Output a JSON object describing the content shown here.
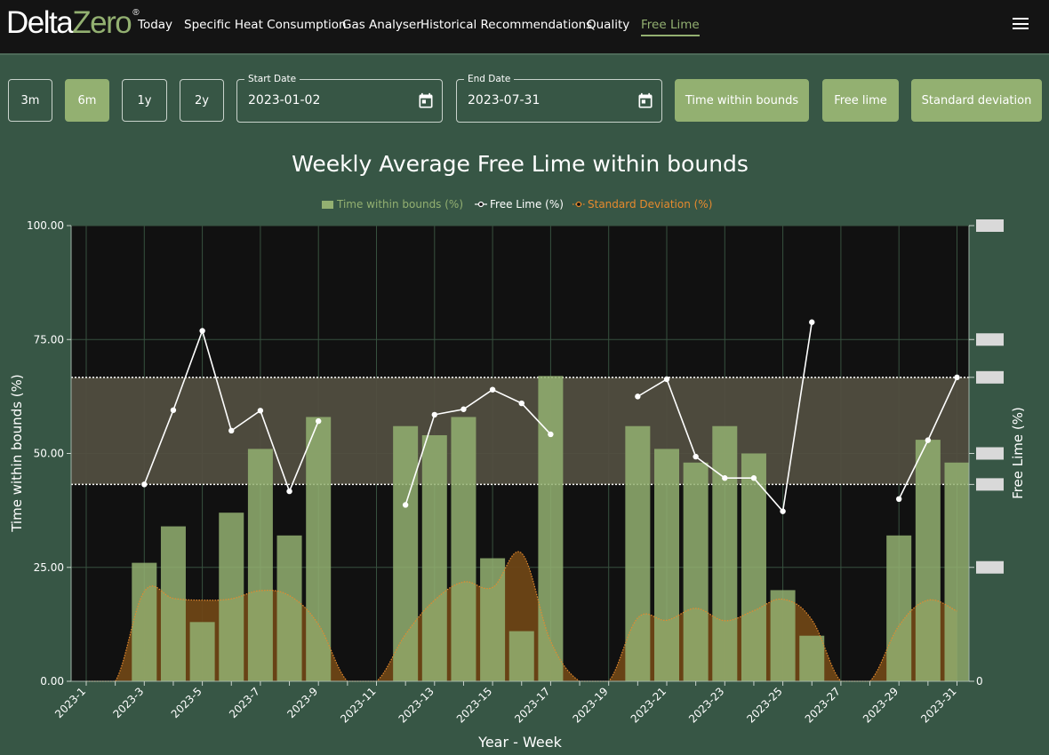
{
  "app": {
    "logo_part1": "Delta",
    "logo_part2": "Zero",
    "logo_mark": "®"
  },
  "nav": {
    "items": [
      "Today",
      "Specific Heat Consumption",
      "Gas Analyser",
      "Historical Recommendations",
      "Quality",
      "Free Lime"
    ],
    "active": "Free Lime",
    "menu_icon": "hamburger-menu-icon"
  },
  "controls": {
    "ranges": [
      "3m",
      "6m",
      "1y",
      "2y"
    ],
    "active_range": "6m",
    "start_date": {
      "label": "Start Date",
      "value": "2023-01-02"
    },
    "end_date": {
      "label": "End Date",
      "value": "2023-07-31"
    },
    "calendar_icon": "calendar-icon",
    "metric_buttons": [
      "Time within bounds",
      "Free lime",
      "Standard deviation"
    ]
  },
  "colors": {
    "accent": "#93b071",
    "background": "#375645",
    "plot_bg": "#111111",
    "bar": "#93b071",
    "line": "#ffffff",
    "std_line": "#e68a2e",
    "std_fill": "#6e4616"
  },
  "chart_data": {
    "type": "bar",
    "title": "Weekly Average Free Lime within bounds",
    "xlabel": "Year - Week",
    "ylabel": "Time within bounds (%)",
    "ylabel_right": "Free Lime (%)",
    "ylim": [
      0,
      100
    ],
    "yticks": [
      "0.00",
      "25.00",
      "50.00",
      "75.00",
      "100.00"
    ],
    "right_yticks": [
      "0"
    ],
    "legend_position": "top-center",
    "grid": true,
    "categories": [
      "2023-1",
      "2023-2",
      "2023-3",
      "2023-4",
      "2023-5",
      "2023-6",
      "2023-7",
      "2023-8",
      "2023-9",
      "2023-10",
      "2023-11",
      "2023-12",
      "2023-13",
      "2023-14",
      "2023-15",
      "2023-16",
      "2023-17",
      "2023-18",
      "2023-19",
      "2023-20",
      "2023-21",
      "2023-22",
      "2023-23",
      "2023-24",
      "2023-25",
      "2023-26",
      "2023-27",
      "2023-28",
      "2023-29",
      "2023-30",
      "2023-31"
    ],
    "xticks": [
      "2023-1",
      "2023-3",
      "2023-5",
      "2023-7",
      "2023-9",
      "2023-11",
      "2023-13",
      "2023-15",
      "2023-17",
      "2023-19",
      "2023-21",
      "2023-23",
      "2023-25",
      "2023-27",
      "2023-29",
      "2023-31"
    ],
    "bounds_band_left_axis": [
      43.2,
      66.7
    ],
    "series": [
      {
        "name": "Time within bounds (%)",
        "type": "bar",
        "axis": "left",
        "values": [
          null,
          null,
          26,
          34,
          13,
          37,
          51,
          32,
          58,
          null,
          null,
          56,
          54,
          58,
          27,
          11,
          67,
          null,
          null,
          56,
          51,
          48,
          56,
          50,
          20,
          10,
          null,
          null,
          32,
          53,
          48
        ]
      },
      {
        "name": "Free Lime (%)",
        "type": "line",
        "axis": "right",
        "values_on_left_scale": [
          null,
          null,
          43.2,
          59.5,
          76.9,
          55.0,
          59.4,
          41.7,
          57.1,
          null,
          null,
          38.7,
          58.5,
          59.7,
          64.0,
          61.0,
          54.2,
          null,
          null,
          62.5,
          66.3,
          49.3,
          44.6,
          44.6,
          37.3,
          78.8,
          null,
          null,
          40.0,
          52.9,
          66.7
        ]
      },
      {
        "name": "Standard Deviation (%)",
        "type": "area",
        "axis": "right",
        "values_on_left_scale": [
          0,
          0,
          19.7,
          18.2,
          17.8,
          18.1,
          19.9,
          18.8,
          12.5,
          0,
          0,
          10.3,
          17.8,
          21.8,
          20.6,
          28.1,
          8.8,
          0,
          0,
          13.9,
          13.4,
          16.0,
          13.3,
          15.5,
          18.0,
          13.5,
          0,
          0,
          12.2,
          17.8,
          15.4
        ]
      }
    ]
  }
}
